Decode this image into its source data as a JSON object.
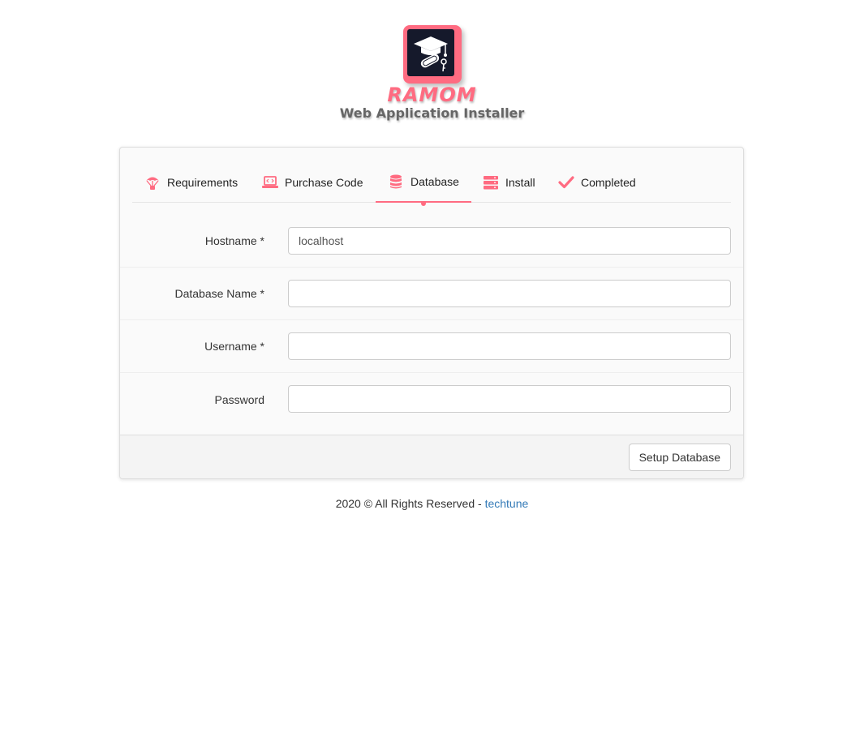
{
  "brand": {
    "name": "RAMOM",
    "subtitle": "Web Application Installer",
    "logo_icon": "graduation-cap-icon",
    "accent_color": "#ff6b81",
    "logo_bg_color": "#15192b"
  },
  "tabs": [
    {
      "label": "Requirements",
      "icon": "parachute-icon",
      "active": false
    },
    {
      "label": "Purchase Code",
      "icon": "laptop-code-icon",
      "active": false
    },
    {
      "label": "Database",
      "icon": "database-icon",
      "active": true
    },
    {
      "label": "Install",
      "icon": "server-icon",
      "active": false
    },
    {
      "label": "Completed",
      "icon": "check-icon",
      "active": false
    }
  ],
  "form": {
    "hostname": {
      "label": "Hostname *",
      "value": "localhost",
      "placeholder": ""
    },
    "database_name": {
      "label": "Database Name *",
      "value": "",
      "placeholder": ""
    },
    "username": {
      "label": "Username *",
      "value": "",
      "placeholder": ""
    },
    "password": {
      "label": "Password",
      "value": "",
      "placeholder": ""
    }
  },
  "actions": {
    "setup_label": "Setup Database"
  },
  "footer": {
    "text": "2020 © All Rights Reserved - ",
    "link_text": "techtune",
    "link_color": "#337ab7"
  }
}
